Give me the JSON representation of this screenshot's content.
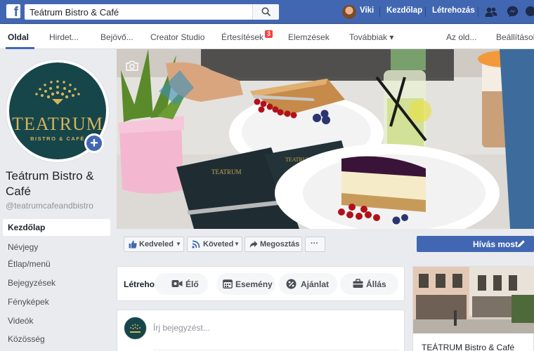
{
  "topbar": {
    "search_value": "Teátrum Bistro & Café",
    "user_name": "Viki",
    "home_label": "Kezdőlap",
    "create_label": "Létrehozás"
  },
  "tabs": [
    {
      "label": "Oldal"
    },
    {
      "label": "Hirdet..."
    },
    {
      "label": "Bejövő..."
    },
    {
      "label": "Creator Studio"
    },
    {
      "label": "Értesítések"
    },
    {
      "label": "Elemzések"
    },
    {
      "label": "Továbbiak ▾"
    },
    {
      "label": "Az old..."
    },
    {
      "label": "Beállítások"
    }
  ],
  "notifications_badge": "3",
  "page": {
    "logo_word": "TEATRUM",
    "logo_sub": "BISTRO & CAFÉ",
    "name": "Teátrum Bistro & Café",
    "handle": "@teatrumcafeandbistro"
  },
  "sidebar": {
    "items": [
      {
        "label": "Kezdőlap"
      },
      {
        "label": "Névjegy"
      },
      {
        "label": "Étlap/menü"
      },
      {
        "label": "Bejegyzések"
      },
      {
        "label": "Fényképek"
      },
      {
        "label": "Videók"
      },
      {
        "label": "Közösség"
      }
    ]
  },
  "actions": {
    "like_label": "Kedveled",
    "follow_label": "Követed",
    "share_label": "Megosztás",
    "more_label": "···",
    "call_label": "Hívás most"
  },
  "create": {
    "label": "Létrehozás",
    "live_label": "Élő",
    "event_label": "Esemény",
    "offer_label": "Ajánlat",
    "job_label": "Állás"
  },
  "composer": {
    "placeholder": "Írj bejegyzést..."
  },
  "right_card": {
    "title": "TEÁTRUM Bistro & Café"
  },
  "colors": {
    "brand_blue": "#4267b2",
    "logo_teal": "#16454a",
    "logo_gold": "#d6b35a",
    "badge_red": "#fa3e3e"
  }
}
